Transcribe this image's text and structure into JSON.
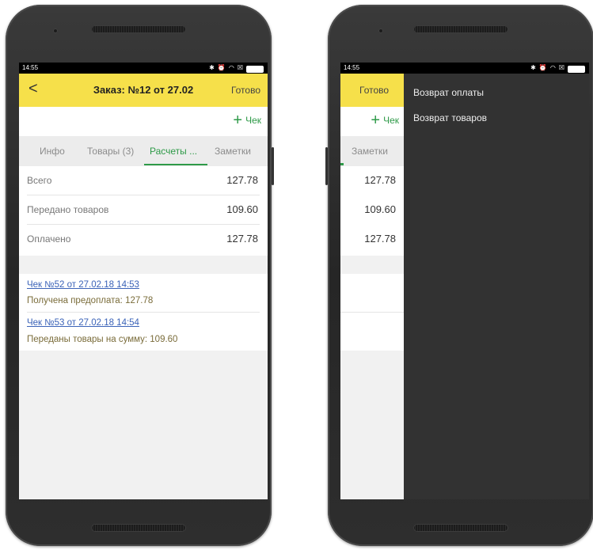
{
  "status_bar": {
    "time": "14:55",
    "icons": [
      "bluetooth-icon",
      "alarm-icon",
      "wifi-icon",
      "sim-icon",
      "battery-icon"
    ]
  },
  "colors": {
    "accent": "#2e9a48",
    "appbar": "#f6e04a",
    "link": "#3b63b8",
    "drawer": "#323232"
  },
  "left_screen": {
    "appbar": {
      "back_glyph": "<",
      "title": "Заказ: №12 от 27.02",
      "done_label": "Готово"
    },
    "toolbar": {
      "add_check_label": "Чек"
    },
    "tabs": [
      {
        "label": "Инфо"
      },
      {
        "label": "Товары (3)"
      },
      {
        "label": "Расчеты ...",
        "active": true
      },
      {
        "label": "Заметки"
      }
    ],
    "totals": [
      {
        "label": "Всего",
        "value": "127.78"
      },
      {
        "label": "Передано товаров",
        "value": "109.60"
      },
      {
        "label": "Оплачено",
        "value": "127.78"
      }
    ],
    "receipts": [
      {
        "link": "Чек №52 от 27.02.18 14:53",
        "description": "Получена предоплата: 127.78"
      },
      {
        "link": "Чек №53 от 27.02.18 14:54",
        "description": "Переданы товары на сумму: 109.60"
      }
    ]
  },
  "right_screen": {
    "appbar": {
      "done_label": "Готово"
    },
    "toolbar": {
      "add_check_label": "Чек"
    },
    "tab_label": "Заметки",
    "values": [
      "127.78",
      "109.60",
      "127.78"
    ],
    "drawer_menu": [
      {
        "label": "Возврат оплаты"
      },
      {
        "label": "Возврат товаров"
      }
    ]
  }
}
